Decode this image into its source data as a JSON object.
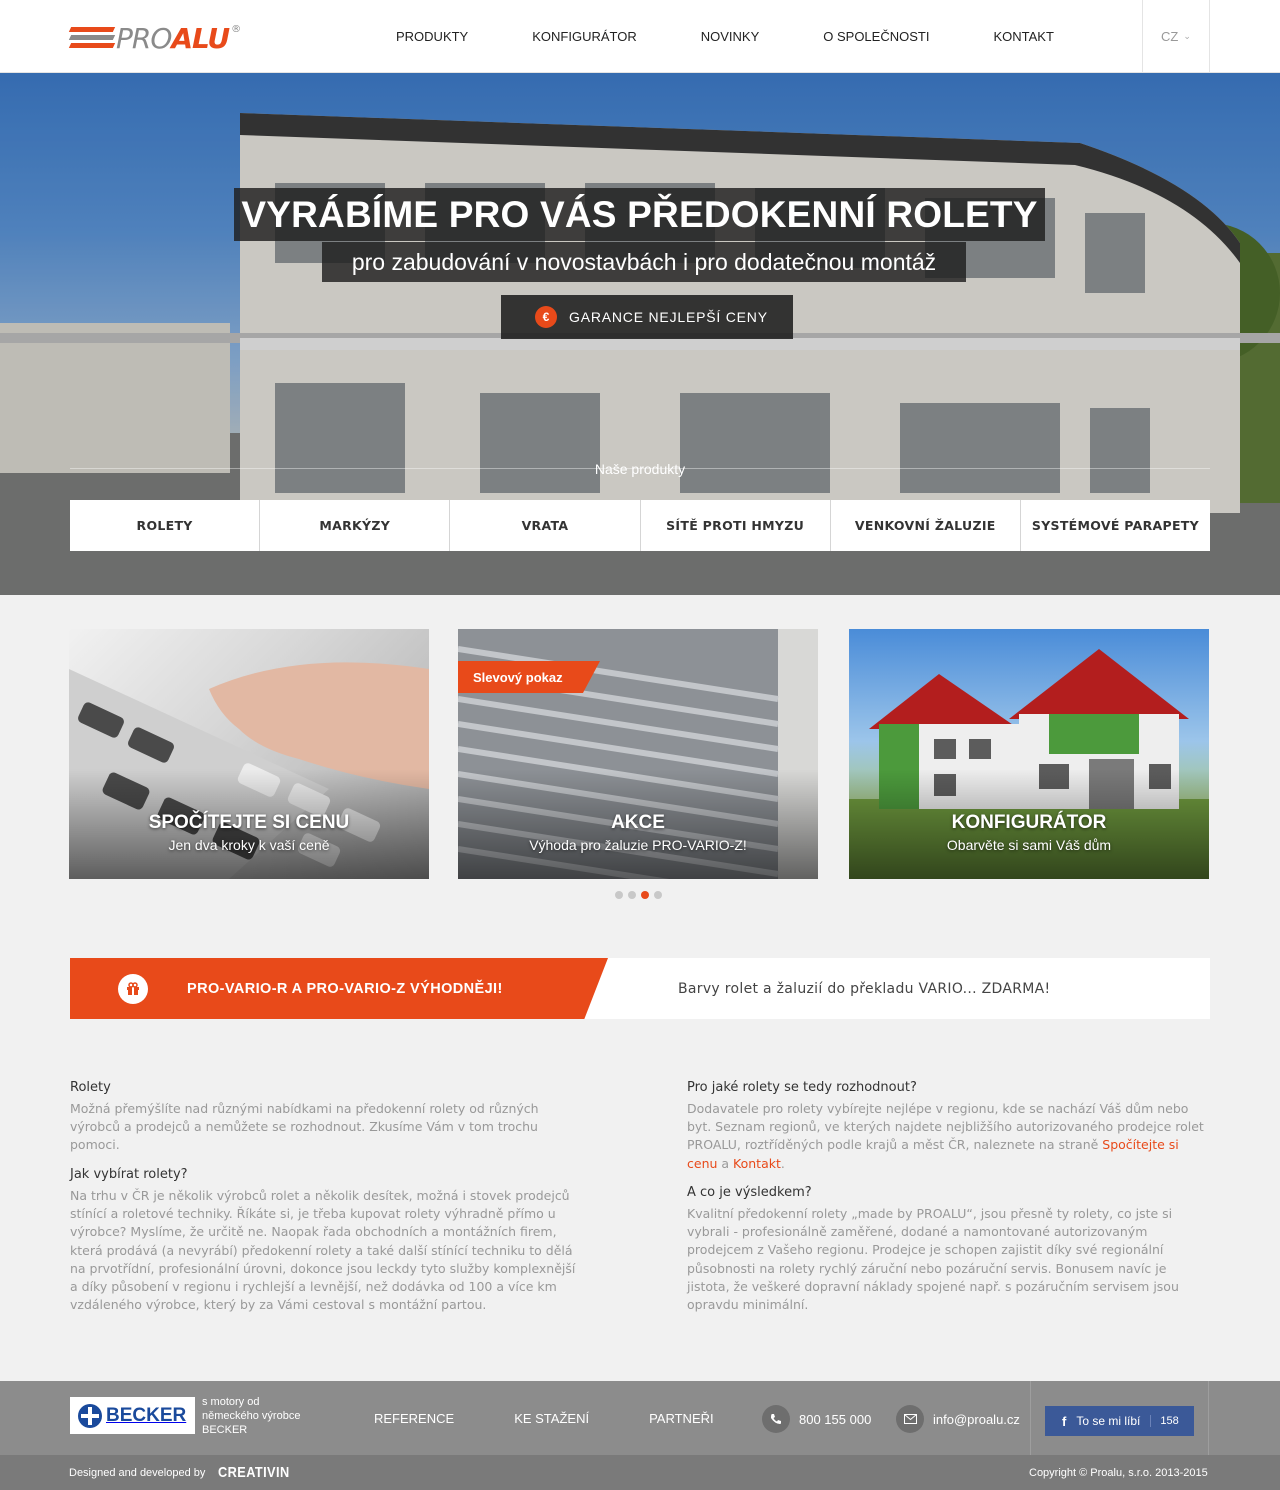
{
  "header": {
    "logo": {
      "pro": "PRO",
      "alu": "ALU",
      "reg": "®"
    },
    "nav": [
      "PRODUKTY",
      "KONFIGURÁTOR",
      "NOVINKY",
      "O SPOLEČNOSTI",
      "KONTAKT"
    ],
    "language": "CZ"
  },
  "hero": {
    "title": "VYRÁBÍME PRO VÁS PŘEDOKENNÍ ROLETY",
    "subtitle": "pro zabudování v novostavbách i pro dodatečnou montáž",
    "guarantee_icon": "€",
    "guarantee_label": "GARANCE NEJLEPŠÍ CENY",
    "products_heading": "Naše produkty",
    "product_tabs": [
      "ROLETY",
      "MARKÝZY",
      "VRATA",
      "SÍTĚ PROTI HMYZU",
      "VENKOVNÍ ŽALUZIE",
      "SYSTÉMOVÉ PARAPETY"
    ]
  },
  "cards": [
    {
      "title": "SPOČÍTEJTE SI CENU",
      "subtitle": "Jen dva kroky k vaší ceně"
    },
    {
      "badge": "Slevový pokaz",
      "title": "AKCE",
      "subtitle": "Výhoda pro žaluzie PRO-VARIO-Z!"
    },
    {
      "title": "KONFIGURÁTOR",
      "subtitle": "Obarvěte si sami Váš dům"
    }
  ],
  "carousel": {
    "count": 4,
    "active_index": 2
  },
  "promo": {
    "title": "PRO-VARIO-R A PRO-VARIO-Z VÝHODNĚJI!",
    "text": "Barvy rolet a žaluzií do překladu VARIO... ZDARMA!"
  },
  "articles": {
    "a1": {
      "heading": "Rolety",
      "text": "Možná přemýšlíte nad různými nabídkami na předokenní rolety od různých výrobců a prodejců a nemůžete se rozhodnout. Zkusíme Vám v tom trochu pomoci."
    },
    "a2": {
      "heading": "Jak vybírat rolety?",
      "text": "Na trhu v ČR je několik výrobců rolet a několik desítek, možná i stovek prodejců stínící a roletové techniky. Říkáte si, je třeba kupovat rolety výhradně přímo u výrobce? Myslíme, že určitě ne. Naopak řada obchodních a montážních firem, která prodává (a nevyrábí) předokenní rolety a také další stínící techniku to dělá na prvotřídní, profesionální úrovni, dokonce jsou leckdy tyto služby komplexnější a díky působení v regionu i rychlejší a levnější, než dodávka od 100 a více km vzdáleného výrobce, který by za Vámi cestoval s montážní partou."
    },
    "a3": {
      "heading": "Pro jaké rolety se tedy rozhodnout?",
      "text_before": "Dodavatele pro rolety vybírejte nejlépe v regionu, kde se nachází Váš dům nebo byt. Seznam regionů, ve kterých najdete nejbližšího autorizovaného prodejce rolet PROALU, roztříděných podle krajů a měst ČR, naleznete na straně ",
      "link1": "Spočítejte si cenu",
      "text_mid": " a ",
      "link2": "Kontakt",
      "text_after": "."
    },
    "a4": {
      "heading": "A co je výsledkem?",
      "text": "Kvalitní předokenní rolety „made by PROALU“, jsou přesně ty rolety, co jste si vybrali - profesionálně zaměřené, dodané a namontované autorizovaným prodejcem z Vašeho regionu. Prodejce je schopen zajistit díky své regionální působnosti na rolety rychlý záruční nebo pozáruční servis. Bonusem navíc je jistota, že veškeré dopravní náklady spojené např. s pozáručním servisem jsou opravdu minimální."
    }
  },
  "footer": {
    "becker_logo": "BECKER",
    "becker_note": "s motory od německého výrobce BECKER",
    "links": [
      "REFERENCE",
      "KE STAŽENÍ",
      "PARTNEŘI"
    ],
    "phone": "800 155 000",
    "email": "info@proalu.cz",
    "fb_icon": "f",
    "fb_label": "To se mi líbí",
    "fb_count": "158",
    "designed_by": "Designed and developed by",
    "agency": "CREATIVIN",
    "copyright": "Copyright © Proalu, s.r.o. 2013-2015"
  },
  "colors": {
    "accent": "#e84a1a",
    "footer": "#8c8c8c",
    "footer_dark": "#7a7a7a",
    "facebook": "#3b5998"
  }
}
